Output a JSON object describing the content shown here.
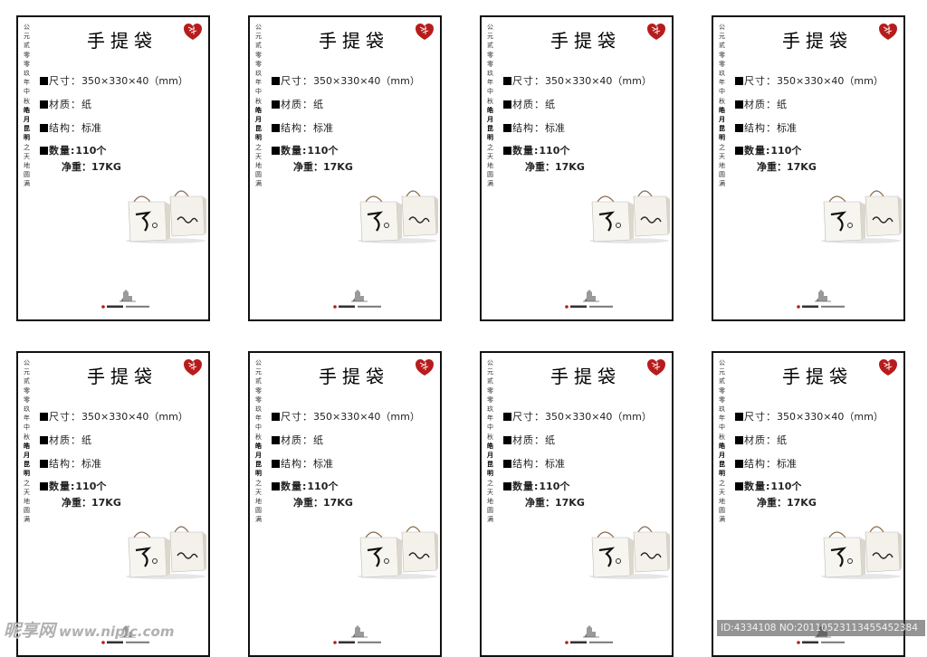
{
  "card": {
    "vertical_text_1": "公元贰零零玖年中秋",
    "vertical_text_bold": "皓月昆明",
    "vertical_text_2": "之天地圆满",
    "title": "手提袋",
    "seal_icon": "red-seal-icon",
    "specs": [
      {
        "label": "尺寸：",
        "value": "350×330×40（mm）"
      },
      {
        "label": "材质：",
        "value": "纸"
      },
      {
        "label": "结构：",
        "value": "标准"
      },
      {
        "label": "数量:",
        "value": "110个"
      }
    ],
    "weight": "净重：17KG",
    "product_image": "gift-bag-pair-image",
    "logo_icon": "hotel-logo-icon"
  },
  "cards_count_visible": 8,
  "colors": {
    "border": "#111111",
    "seal": "#b71c1c",
    "text": "#222222"
  },
  "watermark": {
    "left_text": "昵享网",
    "left_url": "www.nipic.com",
    "right_text": "ID:4334108 NO:20110523113455452384"
  }
}
